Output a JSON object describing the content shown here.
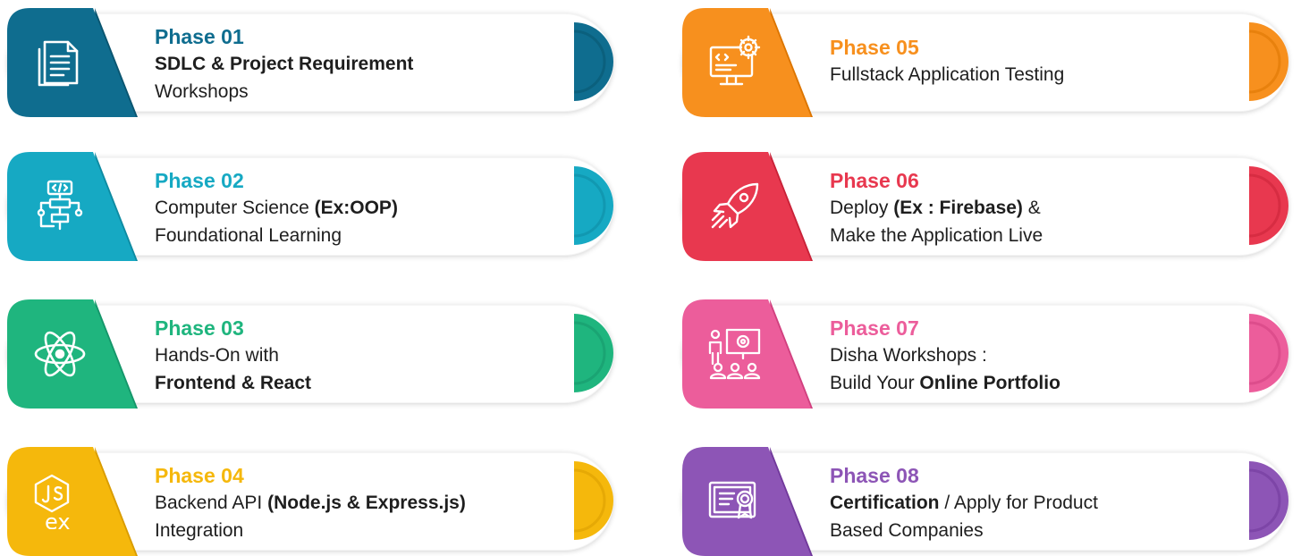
{
  "phases": [
    {
      "id": "01",
      "color": "#0f6d8f",
      "dark": "#0a5570",
      "icon": "document-icon",
      "title": "Phase 01",
      "lines": [
        [
          {
            "t": "SDLC & Project Requirement",
            "b": true
          }
        ],
        [
          {
            "t": "Workshops",
            "b": false
          }
        ]
      ]
    },
    {
      "id": "02",
      "color": "#16a9c3",
      "dark": "#0e8ba2",
      "icon": "code-flowchart-icon",
      "title": "Phase 02",
      "lines": [
        [
          {
            "t": "Computer Science ",
            "b": false
          },
          {
            "t": "(Ex:OOP)",
            "b": true
          }
        ],
        [
          {
            "t": "Foundational Learning",
            "b": false
          }
        ]
      ]
    },
    {
      "id": "03",
      "color": "#1fb57e",
      "dark": "#15966a",
      "icon": "atom-react-icon",
      "title": "Phase 03",
      "lines": [
        [
          {
            "t": "Hands-On with",
            "b": false
          }
        ],
        [
          {
            "t": "Frontend & React",
            "b": true
          }
        ]
      ]
    },
    {
      "id": "04",
      "color": "#f5b80c",
      "dark": "#d99c00",
      "icon": "nodejs-express-icon",
      "title": "Phase 04",
      "lines": [
        [
          {
            "t": "Backend API ",
            "b": false
          },
          {
            "t": "(Node.js & Express.js)",
            "b": true
          }
        ],
        [
          {
            "t": "Integration",
            "b": false
          }
        ]
      ]
    },
    {
      "id": "05",
      "color": "#f7901e",
      "dark": "#dc7500",
      "icon": "monitor-gear-icon",
      "title": "Phase 05",
      "lines": [
        [
          {
            "t": "Fullstack Application Testing",
            "b": false
          }
        ]
      ]
    },
    {
      "id": "06",
      "color": "#e8384f",
      "dark": "#c92238",
      "icon": "rocket-icon",
      "title": "Phase 06",
      "lines": [
        [
          {
            "t": "Deploy ",
            "b": false
          },
          {
            "t": "(Ex : Firebase)",
            "b": true
          },
          {
            "t": " &",
            "b": false
          }
        ],
        [
          {
            "t": "Make the Application Live",
            "b": false
          }
        ]
      ]
    },
    {
      "id": "07",
      "color": "#ec5d9b",
      "dark": "#d1407f",
      "icon": "presentation-audience-icon",
      "title": "Phase 07",
      "lines": [
        [
          {
            "t": "Disha Workshops :",
            "b": false
          }
        ],
        [
          {
            "t": "Build Your ",
            "b": false
          },
          {
            "t": "Online Portfolio",
            "b": true
          }
        ]
      ]
    },
    {
      "id": "08",
      "color": "#8d55b6",
      "dark": "#71399b",
      "icon": "certificate-icon",
      "title": "Phase 08",
      "lines": [
        [
          {
            "t": "Certification",
            "b": true
          },
          {
            "t": " / Apply for Product",
            "b": false
          }
        ],
        [
          {
            "t": "Based Companies",
            "b": false
          }
        ]
      ]
    }
  ]
}
